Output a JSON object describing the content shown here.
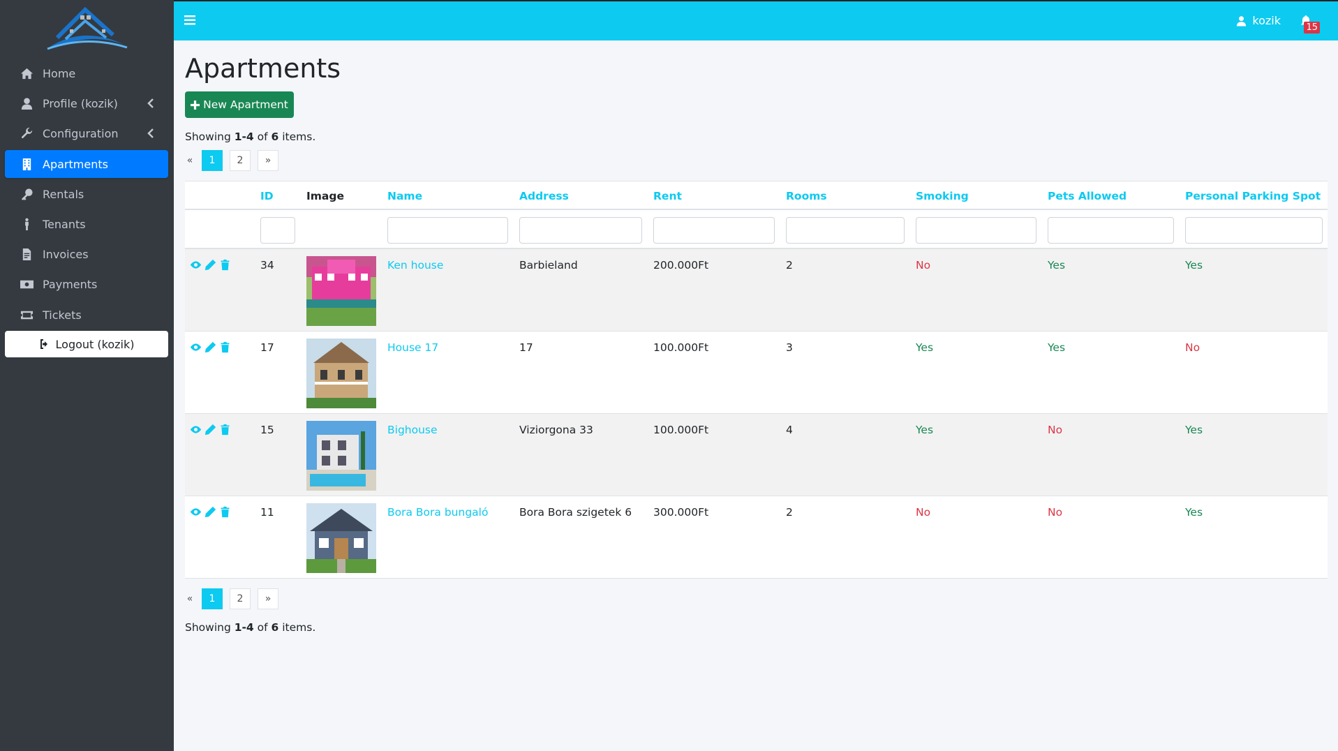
{
  "sidebar": {
    "items": [
      {
        "label": "Home",
        "icon": "home-icon"
      },
      {
        "label": "Profile (kozik)",
        "icon": "user-icon"
      },
      {
        "label": "Configuration",
        "icon": "wrench-icon"
      },
      {
        "label": "Apartments",
        "icon": "building-icon"
      },
      {
        "label": "Rentals",
        "icon": "key-icon"
      },
      {
        "label": "Tenants",
        "icon": "person-icon"
      },
      {
        "label": "Invoices",
        "icon": "invoice-icon"
      },
      {
        "label": "Payments",
        "icon": "money-icon"
      },
      {
        "label": "Tickets",
        "icon": "ticket-icon"
      }
    ],
    "logout_label": "Logout (kozik)",
    "active_color": "#007bff"
  },
  "topbar": {
    "username": "kozik",
    "notification_count": "15",
    "color": "#0dcaf0"
  },
  "page": {
    "title": "Apartments",
    "new_button_label": "New Apartment"
  },
  "summary": {
    "prefix": "Showing ",
    "range": "1-4",
    "mid": " of ",
    "total": "6",
    "suffix": " items."
  },
  "pagination": {
    "prev": "«",
    "pages": [
      "1",
      "2"
    ],
    "next": "»",
    "active_page": "1"
  },
  "table": {
    "headers": {
      "id": "ID",
      "image": "Image",
      "name": "Name",
      "address": "Address",
      "rent": "Rent",
      "rooms": "Rooms",
      "smoking": "Smoking",
      "pets": "Pets Allowed",
      "parking": "Personal Parking Spot"
    },
    "rows": [
      {
        "id": "34",
        "image": "pink-house-photo",
        "name": "Ken house",
        "address": "Barbieland",
        "rent": "200.000Ft",
        "rooms": "2",
        "smoking": "No",
        "pets": "Yes",
        "parking": "Yes"
      },
      {
        "id": "17",
        "image": "victorian-house-photo",
        "name": "House 17",
        "address": "17",
        "rent": "100.000Ft",
        "rooms": "3",
        "smoking": "Yes",
        "pets": "Yes",
        "parking": "No"
      },
      {
        "id": "15",
        "image": "pool-house-photo",
        "name": "Bighouse",
        "address": "Viziorgona 33",
        "rent": "100.000Ft",
        "rooms": "4",
        "smoking": "Yes",
        "pets": "No",
        "parking": "Yes"
      },
      {
        "id": "11",
        "image": "bungalow-photo",
        "name": "Bora Bora bungaló",
        "address": "Bora Bora szigetek 6",
        "rent": "300.000Ft",
        "rooms": "2",
        "smoking": "No",
        "pets": "No",
        "parking": "Yes"
      }
    ]
  }
}
